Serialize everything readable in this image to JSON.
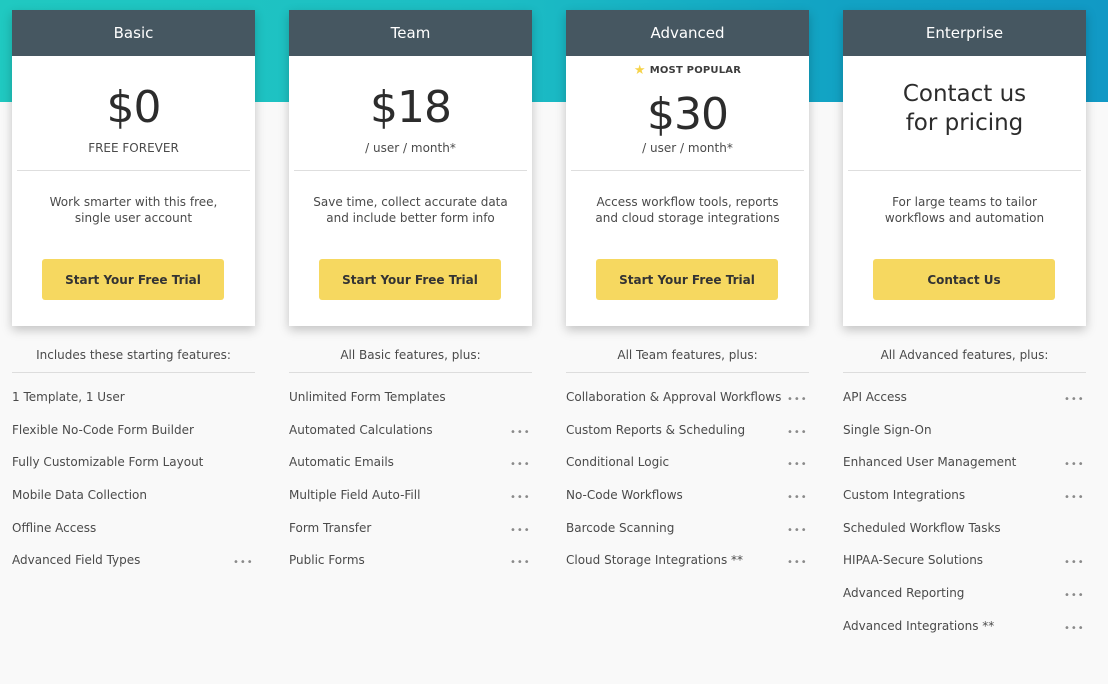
{
  "colors": {
    "header_bg": "#465761",
    "button_bg": "#f6d860",
    "band_start": "#20c9c1",
    "band_end": "#1199c5",
    "star": "#f6d34a"
  },
  "plans": [
    {
      "name": "Basic",
      "badge": "",
      "price": "$0",
      "price_sub": "FREE FOREVER",
      "description": "Work smarter with this free, single user account",
      "button_label": "Start Your Free Trial",
      "features_heading": "Includes these starting features:",
      "features": [
        {
          "label": "1 Template, 1 User",
          "more": false
        },
        {
          "label": "Flexible No-Code Form Builder",
          "more": false
        },
        {
          "label": "Fully Customizable Form Layout",
          "more": false
        },
        {
          "label": "Mobile Data Collection",
          "more": false
        },
        {
          "label": "Offline Access",
          "more": false
        },
        {
          "label": "Advanced Field Types",
          "more": true
        }
      ]
    },
    {
      "name": "Team",
      "badge": "",
      "price": "$18",
      "price_sub": "/ user / month*",
      "description": "Save time, collect accurate data and include better form info",
      "button_label": "Start Your Free Trial",
      "features_heading": "All Basic features, plus:",
      "features": [
        {
          "label": "Unlimited Form Templates",
          "more": false
        },
        {
          "label": "Automated Calculations",
          "more": true
        },
        {
          "label": "Automatic Emails",
          "more": true
        },
        {
          "label": "Multiple Field Auto-Fill",
          "more": true
        },
        {
          "label": "Form Transfer",
          "more": true
        },
        {
          "label": "Public Forms",
          "more": true
        }
      ]
    },
    {
      "name": "Advanced",
      "badge": "MOST POPULAR",
      "price": "$30",
      "price_sub": "/ user / month*",
      "description": "Access workflow tools, reports and cloud storage integrations",
      "button_label": "Start Your Free Trial",
      "features_heading": "All Team features, plus:",
      "features": [
        {
          "label": "Collaboration & Approval Workflows",
          "more": true
        },
        {
          "label": "Custom Reports & Scheduling",
          "more": true
        },
        {
          "label": "Conditional Logic",
          "more": true
        },
        {
          "label": "No-Code Workflows",
          "more": true
        },
        {
          "label": "Barcode Scanning",
          "more": true
        },
        {
          "label": "Cloud Storage Integrations **",
          "more": true
        }
      ]
    },
    {
      "name": "Enterprise",
      "badge": "",
      "price_line1": "Contact us",
      "price_line2": "for pricing",
      "description": "For large teams to tailor workflows and automation",
      "button_label": "Contact Us",
      "features_heading": "All Advanced features, plus:",
      "features": [
        {
          "label": "API Access",
          "more": true
        },
        {
          "label": "Single Sign-On",
          "more": false
        },
        {
          "label": "Enhanced User Management",
          "more": true
        },
        {
          "label": "Custom Integrations",
          "more": true
        },
        {
          "label": "Scheduled Workflow Tasks",
          "more": false
        },
        {
          "label": "HIPAA-Secure Solutions",
          "more": true
        },
        {
          "label": "Advanced Reporting",
          "more": true
        },
        {
          "label": "Advanced Integrations **",
          "more": true
        }
      ]
    }
  ],
  "icons": {
    "star": "star-icon",
    "more": "more-dots-icon"
  },
  "glyphs": {
    "star": "★",
    "more": "•••"
  }
}
